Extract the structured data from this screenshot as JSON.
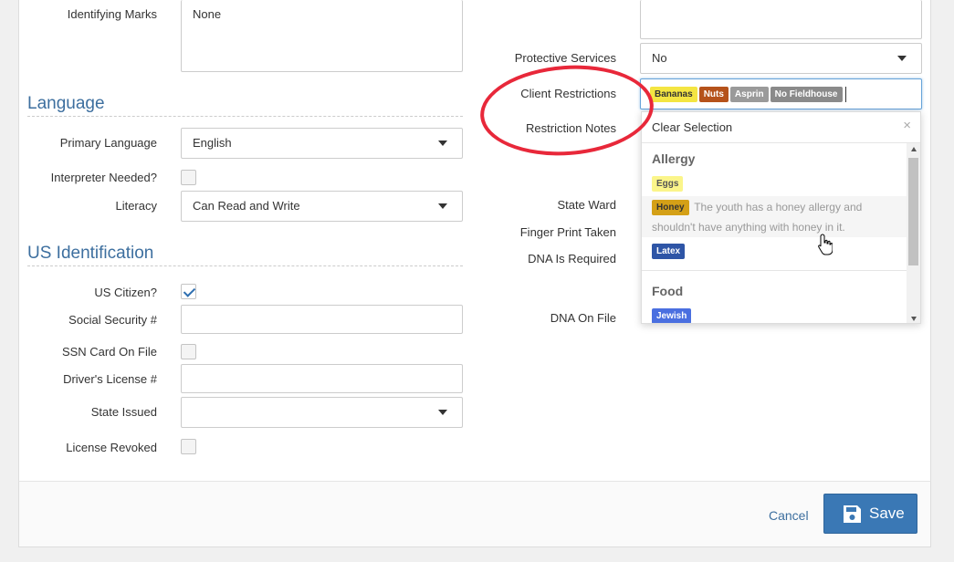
{
  "left": {
    "identifying_marks_label": "Identifying Marks",
    "identifying_marks_value": "None",
    "language_heading": "Language",
    "primary_language_label": "Primary Language",
    "primary_language_value": "English",
    "interpreter_label": "Interpreter Needed?",
    "literacy_label": "Literacy",
    "literacy_value": "Can Read and Write",
    "us_id_heading": "US Identification",
    "us_citizen_label": "US Citizen?",
    "us_citizen_checked": true,
    "ssn_label": "Social Security #",
    "ssn_card_label": "SSN Card On File",
    "drivers_license_label": "Driver's License #",
    "state_issued_label": "State Issued",
    "license_revoked_label": "License Revoked"
  },
  "right": {
    "protective_services_label": "Protective Services",
    "protective_services_value": "No",
    "client_restrictions_label": "Client Restrictions",
    "restriction_notes_label": "Restriction Notes",
    "state_ward_label": "State Ward",
    "finger_print_label": "Finger Print Taken",
    "dna_required_label": "DNA Is Required",
    "dna_on_file_label": "DNA On File",
    "selected_tags": [
      {
        "label": "Bananas",
        "bg": "#f4e542",
        "fg": "#333333"
      },
      {
        "label": "Nuts",
        "bg": "#b5521b",
        "fg": "#ffffff"
      },
      {
        "label": "Asprin",
        "bg": "#9a9a9a",
        "fg": "#ffffff"
      },
      {
        "label": "No Fieldhouse",
        "bg": "#8a8a8a",
        "fg": "#ffffff"
      }
    ]
  },
  "dropdown": {
    "clear_selection": "Clear Selection",
    "close_symbol": "×",
    "groups": [
      {
        "name": "Allergy",
        "options": [
          {
            "tag": "Eggs",
            "bg": "#fbf58a",
            "fg": "#555555",
            "note": ""
          },
          {
            "tag": "Honey",
            "bg": "#d4a017",
            "fg": "#333333",
            "note": "The youth has a honey allergy and shouldn't have anything with honey in it."
          },
          {
            "tag": "Latex",
            "bg": "#2e55a6",
            "fg": "#ffffff",
            "note": ""
          }
        ]
      },
      {
        "name": "Food",
        "options": [
          {
            "tag": "Jewish",
            "bg": "#4a6fe0",
            "fg": "#ffffff",
            "note": ""
          }
        ]
      }
    ]
  },
  "footer": {
    "cancel_label": "Cancel",
    "save_label": "Save"
  },
  "colors": {
    "accent": "#3a78b5",
    "heading": "#3d6f9f",
    "annotation": "#e8283a"
  }
}
